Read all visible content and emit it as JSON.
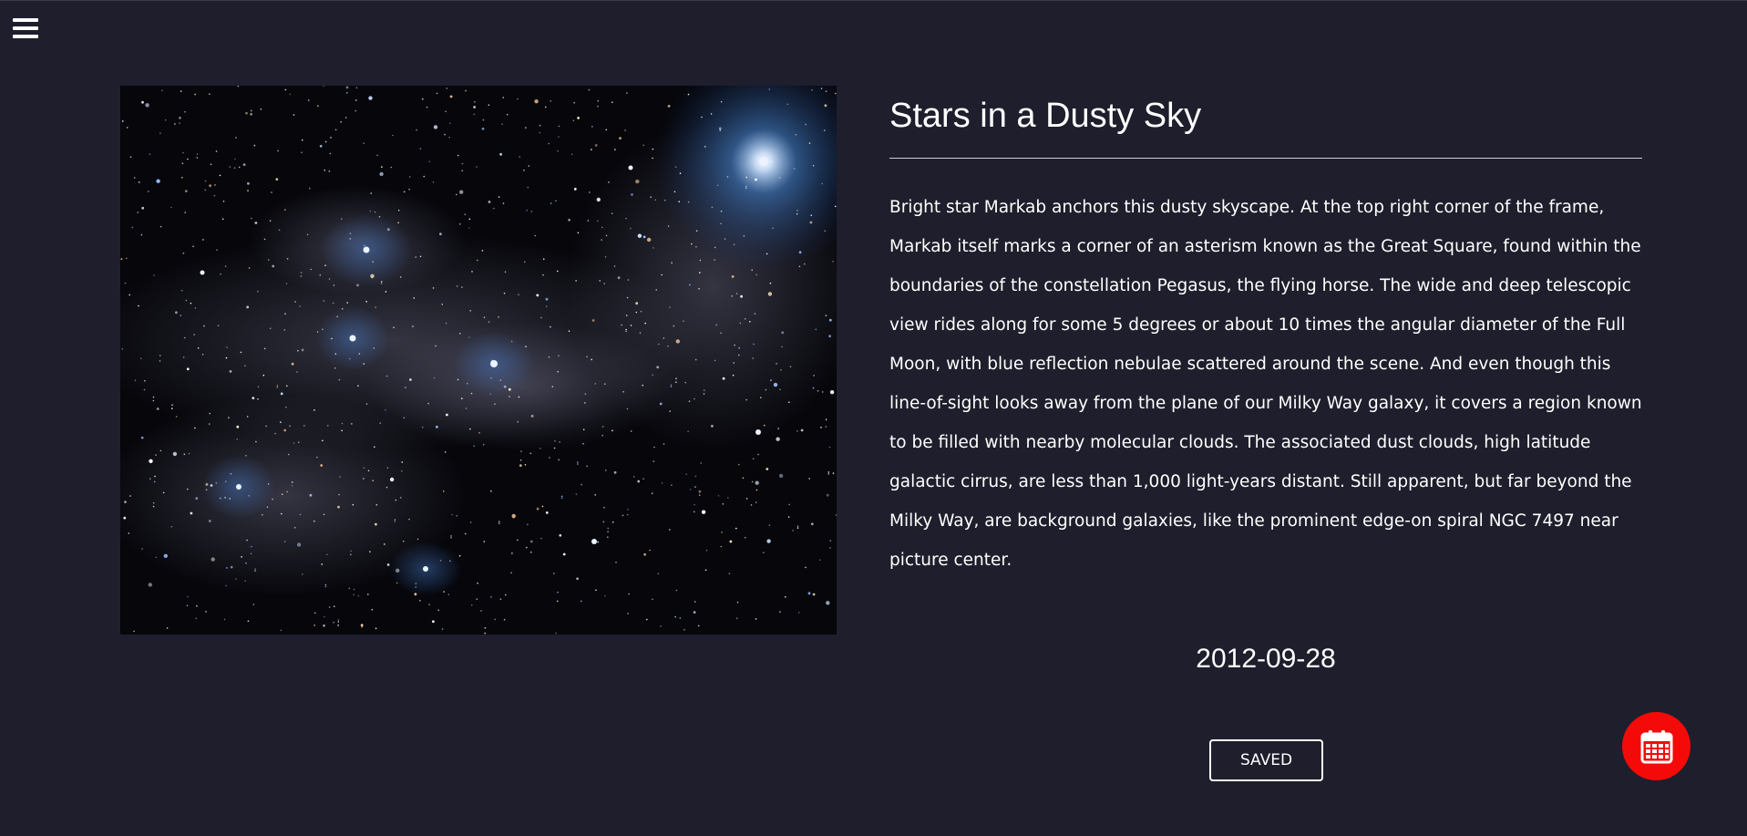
{
  "menu": {
    "icon": "hamburger-menu-icon"
  },
  "apod": {
    "title": "Stars in a Dusty Sky",
    "description": "Bright star Markab anchors this dusty skyscape. At the top right corner of the frame, Markab itself marks a corner of an asterism known as the Great Square, found within the boundaries of the constellation Pegasus, the flying horse. The wide and deep telescopic view rides along for some 5 degrees or about 10 times the angular diameter of the Full Moon, with blue reflection nebulae scattered around the scene. And even though this line-of-sight looks away from the plane of our Milky Way galaxy, it covers a region known to be filled with nearby molecular clouds. The associated dust clouds, high latitude galactic cirrus, are less than 1,000 light-years distant. Still apparent, but far beyond the Milky Way, are background galaxies, like the prominent edge-on spiral NGC 7497 near picture center.",
    "date": "2012-09-28",
    "saved_label": "SAVED"
  },
  "fab": {
    "icon": "calendar-icon",
    "color": "#f50a0a"
  },
  "colors": {
    "background": "#1e1e2c",
    "text": "#ffffff"
  }
}
